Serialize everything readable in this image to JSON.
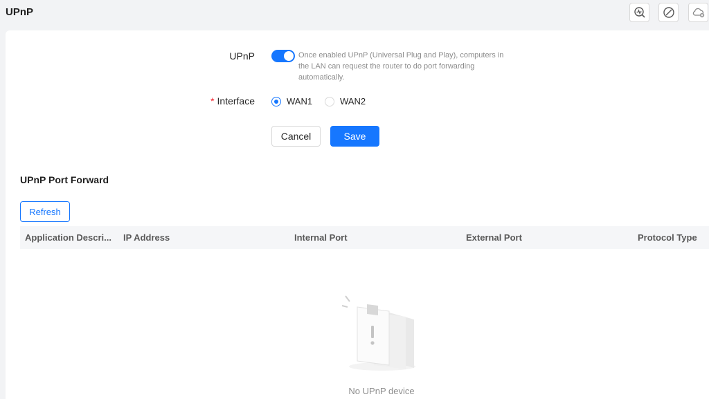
{
  "header": {
    "title": "UPnP"
  },
  "toolbar": {
    "icons": [
      "diagnose-icon",
      "block-icon",
      "cloud-disconnected-icon"
    ]
  },
  "form": {
    "upnp_label": "UPnP",
    "upnp_enabled": true,
    "upnp_description": "Once enabled UPnP (Universal Plug and Play), computers in the LAN can request the router to do port forwarding automatically.",
    "interface_label": "Interface",
    "interface_required": "*",
    "interface_options": [
      {
        "label": "WAN1",
        "checked": true
      },
      {
        "label": "WAN2",
        "checked": false
      }
    ],
    "cancel_label": "Cancel",
    "save_label": "Save"
  },
  "port_forward": {
    "title": "UPnP Port Forward",
    "refresh_label": "Refresh",
    "columns": [
      "Application Descri...",
      "IP Address",
      "Internal Port",
      "External Port",
      "Protocol Type"
    ],
    "rows": [],
    "empty_text": "No UPnP device"
  },
  "colors": {
    "accent": "#1677ff",
    "required": "#f5222d",
    "page_bg": "#f2f3f5"
  }
}
